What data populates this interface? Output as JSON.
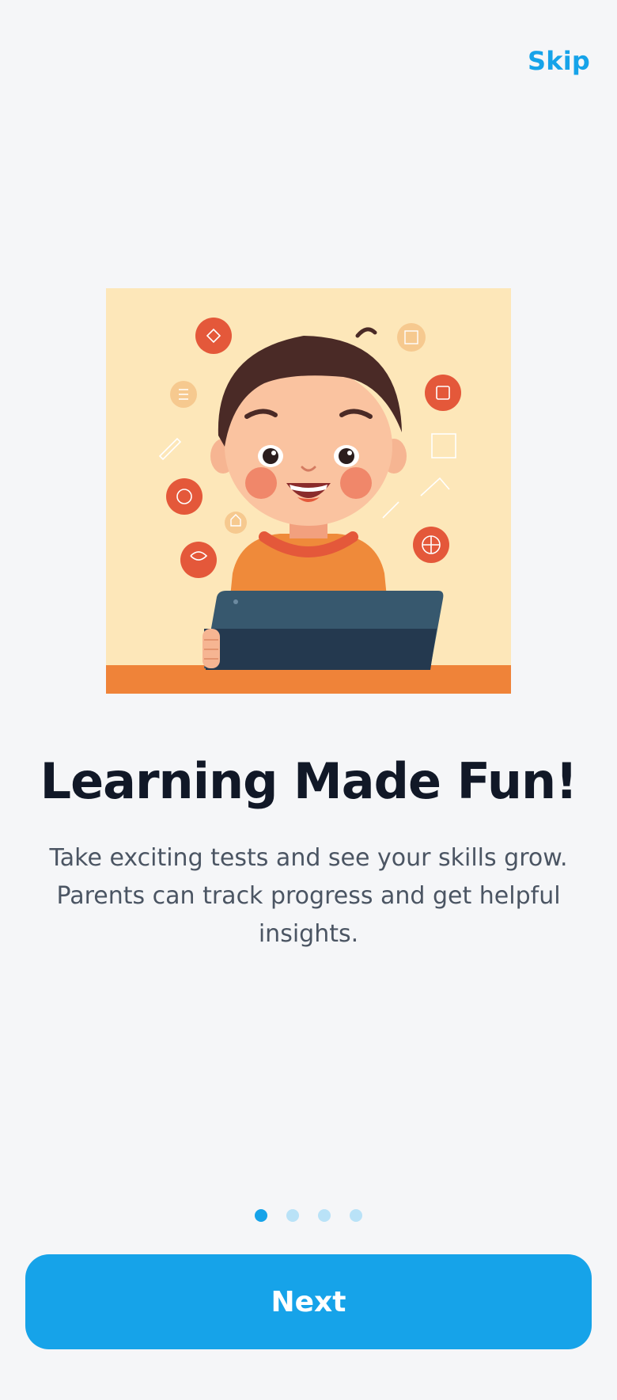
{
  "header": {
    "skip_label": "Skip"
  },
  "illustration": {
    "icon": "child-with-tablet-illustration"
  },
  "slide": {
    "title": "Learning Made Fun!",
    "description": "Take exciting tests and see your skills grow. Parents can track progress and get helpful insights."
  },
  "pagination": {
    "total": 4,
    "current": 1
  },
  "footer": {
    "next_label": "Next"
  },
  "colors": {
    "accent": "#16a3e9",
    "accent_light": "#b9e2f7",
    "background": "#f5f6f8",
    "title": "#111827",
    "body_text": "#4b5563"
  }
}
